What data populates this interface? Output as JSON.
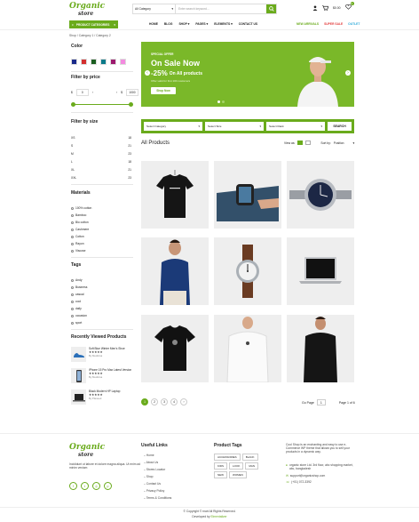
{
  "header": {
    "logo_line1": "Organic",
    "logo_line2": "store",
    "search_category": "All Category",
    "search_placeholder": "Enter search keyword...",
    "cart_total": "$0.00",
    "cart_count": "0",
    "wishlist_count": "0",
    "categories_button": "PRODUCT CATEGORIES",
    "nav": [
      "HOME",
      "BLOG",
      "SHOP",
      "PAGES",
      "ELEMENTS",
      "CONTACT US"
    ],
    "promo": [
      {
        "label": "NEW ARRIVALS",
        "color": "#6aab1c"
      },
      {
        "label": "SUPER SALE",
        "color": "#e23b3b"
      },
      {
        "label": "OUTLET",
        "color": "#2aa8d8"
      }
    ]
  },
  "breadcrumb": "Shop  /  Category 1  /  Category 2",
  "sidebar": {
    "color_title": "Color",
    "colors": [
      "#1a2a8a",
      "#d32f2f",
      "#1b5e20",
      "#0b7a8a",
      "#9c1a6e",
      "#f38adf"
    ],
    "price_title": "Filter by price",
    "price_min": "0",
    "price_max": "1000",
    "price_currency": "$",
    "size_title": "Filter by size",
    "sizes": [
      {
        "label": "XS",
        "count": "18"
      },
      {
        "label": "S",
        "count": "21"
      },
      {
        "label": "M",
        "count": "23"
      },
      {
        "label": "L",
        "count": "18"
      },
      {
        "label": "XL",
        "count": "21"
      },
      {
        "label": "XXL",
        "count": "23"
      }
    ],
    "materials_title": "Materials",
    "materials": [
      "100% cotton",
      "Bamboo",
      "Bio cotton",
      "Cashmere",
      "Cotton",
      "Rayon",
      "Viscose"
    ],
    "tags_title": "Tags",
    "tags": [
      "Andy",
      "Business",
      "casual",
      "cool",
      "daily",
      "occasion",
      "sport"
    ],
    "recent_title": "Recently Viewed Products",
    "recent": [
      {
        "name": "Soft Blue Winter Men's Shoe",
        "rating": "★★★★★",
        "brand": "By Medicina"
      },
      {
        "name": "iPhone 15 Pro Max Latest Version",
        "rating": "★★★★★",
        "brand": "By Medicina"
      },
      {
        "name": "Black Modern HP Laptop",
        "rating": "★★★★★",
        "brand": "By Planeed"
      }
    ]
  },
  "banner": {
    "kicker": "SPECIAL OFFER",
    "headline": "On Sale Now",
    "discount": "-25%",
    "sub": "On All products",
    "note": "Offer valid for first 100 customers",
    "cta": "Shop Now"
  },
  "filter": {
    "category": "Select Category",
    "size": "Select Size",
    "rating": "Select Rank",
    "search": "SEARCH"
  },
  "products": {
    "title": "All Products",
    "view_label": "View as:",
    "sort_label": "Sort by:",
    "sort_value": "Position",
    "items": [
      {
        "name": "black-tshirt"
      },
      {
        "name": "smart-watch"
      },
      {
        "name": "steel-watch"
      },
      {
        "name": "polo-shirt-man"
      },
      {
        "name": "leather-watch"
      },
      {
        "name": "laptop"
      },
      {
        "name": "black-tshirt-2"
      },
      {
        "name": "white-tshirt"
      },
      {
        "name": "black-shirt-man"
      }
    ]
  },
  "pagination": {
    "pages": [
      "1",
      "2",
      "3",
      "4"
    ],
    "next": "›",
    "go_to": "Go Page",
    "current": "1",
    "info": "Page 1 of 6"
  },
  "footer": {
    "about": "Incididunt ut labore et dolore magna aliqua. Ut enim ad minim veniam",
    "links_title": "Useful Links",
    "links": [
      "Home",
      "About Us",
      "Stores Locator",
      "Shop",
      "Contact Us",
      "Privacy Policy",
      "Terms & Conditions"
    ],
    "tags_title": "Product Tags",
    "tags": [
      "ACCESSORIES",
      "BLACK",
      "KIDS",
      "LOOK",
      "MAN",
      "NEW",
      "WOMEN"
    ],
    "contact_text": "Cool Shop is an enchanting and easy to use e-Commerce WP theme that allows you to sell your products in a dynamic way.",
    "address": "organic store Ltd. 3rd floor, abc shopping market, abc, bangladesh",
    "email": "support@organicshop.com",
    "phone": "(+01) 072-3392",
    "copyright": "© Copyright © mart All Rights Reserved.",
    "developed_prefix": "Developed by ",
    "developer": "Elmentalizer"
  },
  "colors": {
    "accent": "#6aab1c",
    "banner_bg": "#7ab829"
  }
}
